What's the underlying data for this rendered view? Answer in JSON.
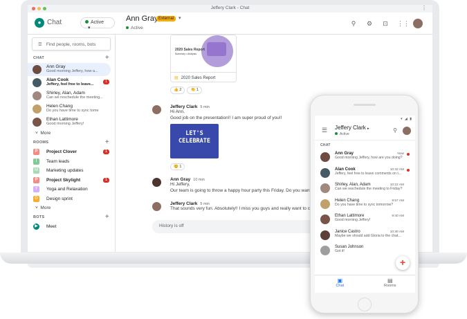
{
  "window": {
    "title": "Jeffery Clark - Chat",
    "menu_glyph": "⋮",
    "dot_colors": [
      "#ee6a5f",
      "#f5be4f",
      "#62c554"
    ]
  },
  "app": {
    "name": "Chat",
    "status_label": "Active",
    "status_caret": "▾"
  },
  "conversation": {
    "name": "Ann Gray",
    "badge": "External",
    "caret": "▾",
    "status": "Active"
  },
  "header_icons": [
    "search-icon",
    "settings-icon",
    "feedback-icon",
    "apps-icon"
  ],
  "header_glyphs": [
    "⚲",
    "⚙",
    "⊡",
    "⋮⋮"
  ],
  "sidebar": {
    "search_icon": "☰",
    "search_placeholder": "Find people, rooms, bots",
    "chat_header": "CHAT",
    "plus": "+",
    "chats": [
      {
        "name": "Ann Gray",
        "preview": "Good morning Jeffery, how a...",
        "bold": false,
        "badge": "",
        "color": "#6d4c41",
        "selected": true
      },
      {
        "name": "Alan Cook",
        "preview": "Jeffery, feel free to leave...",
        "bold": true,
        "badge": "1",
        "color": "#455a64",
        "selected": false
      },
      {
        "name": "Shirley, Alan, Adam",
        "preview": "Can we reschedule the meeting...",
        "bold": false,
        "badge": "",
        "color": "#a1887f",
        "selected": false
      },
      {
        "name": "Helen Chang",
        "preview": "Do you have time to sync tome",
        "bold": false,
        "badge": "",
        "color": "#c0a16b",
        "selected": false
      },
      {
        "name": "Ethan Lattimore",
        "preview": "Good morning Jeffery!",
        "bold": false,
        "badge": "",
        "color": "#795548",
        "selected": false
      }
    ],
    "more_label": "More",
    "more_glyph": "˅",
    "rooms_header": "ROOMS",
    "rooms": [
      {
        "name": "Project Clover",
        "letter": "P",
        "color": "#f28b82",
        "bold": true,
        "badge": "1"
      },
      {
        "name": "Team leads",
        "letter": "T",
        "color": "#81c995",
        "bold": false,
        "badge": ""
      },
      {
        "name": "Marketing updates",
        "letter": "M",
        "color": "#a8dab5",
        "bold": false,
        "badge": ""
      },
      {
        "name": "Project Skylight",
        "letter": "P",
        "color": "#f28b82",
        "bold": true,
        "badge": "1"
      },
      {
        "name": "Yoga and Relaxation",
        "letter": "Y",
        "color": "#d7aefb",
        "bold": false,
        "badge": ""
      },
      {
        "name": "Design sprint",
        "letter": "D",
        "color": "#f6ae2d",
        "bold": false,
        "badge": ""
      }
    ],
    "rooms_more_label": "More",
    "bots_header": "BOTS",
    "bots": [
      {
        "name": "Meet",
        "color": "#00897b"
      }
    ]
  },
  "thread": {
    "card_title": "2020 Sales Report",
    "card_subtitle": "Summary • Analysis",
    "card_file": "2020 Sales Report",
    "card_file_icon": "▤",
    "reactions": [
      "👍 2",
      "👏 1"
    ],
    "messages": [
      {
        "name": "Jeffery Clark",
        "time": "5 min",
        "lines": [
          "Hi Ann,",
          "Good job on the presentation!! I am super proud of you!!"
        ],
        "color": "#8d6e63",
        "image": "LET'S CELEBRATE",
        "reaction": "😊 1"
      },
      {
        "name": "Ann Gray",
        "time": "10 min",
        "lines": [
          "Hi Jeffery,",
          "Our team is going to throw a happy hour party this Friday. Do you want to jo"
        ],
        "color": "#4e342e"
      },
      {
        "name": "Jeffery Clark",
        "time": "5 min",
        "lines": [
          "That sounds very fun. Absolutely!! I miss you guys and really want to catch u"
        ],
        "color": "#8d6e63"
      }
    ],
    "compose_placeholder": "History is off"
  },
  "phone": {
    "status_icons": "▾ ◢ ▮",
    "title": "Jeffery Clark",
    "title_caret": "▸",
    "status": "Active",
    "menu_glyph": "☰",
    "search_glyph": "⚲",
    "chat_header": "CHAT",
    "chats": [
      {
        "name": "Ann Gray",
        "preview": "Good morning Jeffery, how are you doing?",
        "time": "Now",
        "bold": true,
        "unread": true,
        "color": "#6d4c41"
      },
      {
        "name": "Alan Cook",
        "preview": "Jeffery, feel free to leave comments on t...",
        "time": "10:32 AM",
        "bold": true,
        "unread": true,
        "color": "#455a64"
      },
      {
        "name": "Shirley, Alan, Adam",
        "preview": "Can we reschedule the meeting to Friday?",
        "time": "10:22 AM",
        "bold": false,
        "unread": false,
        "color": "#a1887f"
      },
      {
        "name": "Helen Chang",
        "preview": "Do you have time to sync tomorrow?",
        "time": "9:57 AM",
        "bold": false,
        "unread": false,
        "color": "#c0a16b"
      },
      {
        "name": "Ethan Lattimore",
        "preview": "Good morning Jeffery!",
        "time": "9:40 AM",
        "bold": false,
        "unread": false,
        "color": "#795548"
      },
      {
        "name": "Janice Castro",
        "preview": "Maybe we should add Gloria to the chat...",
        "time": "10:30 AM",
        "bold": false,
        "unread": false,
        "color": "#5d4037"
      },
      {
        "name": "Susan Johnson",
        "preview": "Got it!",
        "time": "",
        "bold": false,
        "unread": false,
        "color": "#9e9e9e"
      }
    ],
    "fab_glyph": "+",
    "tabs": [
      {
        "label": "Chat",
        "glyph": "▣",
        "active": true
      },
      {
        "label": "Rooms",
        "glyph": "▤",
        "active": false
      }
    ]
  }
}
